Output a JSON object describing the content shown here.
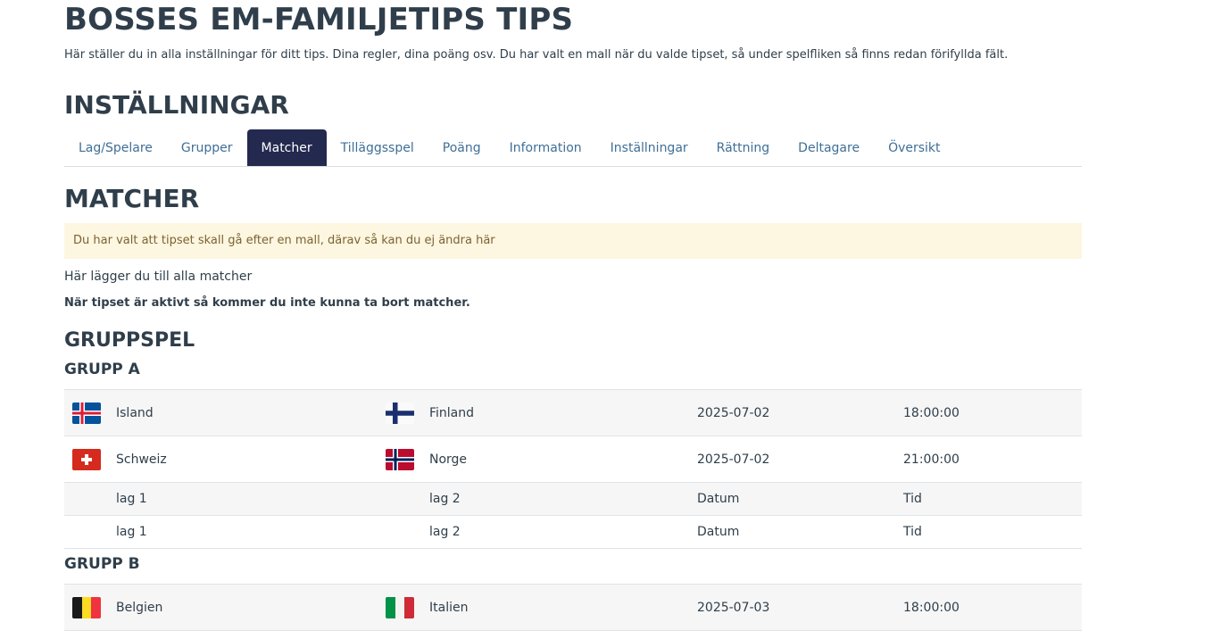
{
  "header": {
    "title": "BOSSES EM-FAMILJETIPS TIPS",
    "intro": "Här ställer du in alla inställningar för ditt tips. Dina regler, dina poäng osv. Du har valt en mall när du valde tipset, så under spelfliken så finns redan förifyllda fält."
  },
  "settings": {
    "title": "INSTÄLLNINGAR",
    "tabs": [
      {
        "label": "Lag/Spelare"
      },
      {
        "label": "Grupper"
      },
      {
        "label": "Matcher",
        "active": true
      },
      {
        "label": "Tilläggsspel"
      },
      {
        "label": "Poäng"
      },
      {
        "label": "Information"
      },
      {
        "label": "Inställningar"
      },
      {
        "label": "Rättning"
      },
      {
        "label": "Deltagare"
      },
      {
        "label": "Översikt"
      }
    ],
    "active_tab_color": "#23294f"
  },
  "matches": {
    "title": "MATCHER",
    "notice": "Du har valt att tipset skall gå efter en mall, därav så kan du ej ändra här",
    "helper": "Här lägger du till alla matcher",
    "warning": "När tipset är aktivt så kommer du inte kunna ta bort matcher.",
    "stage_title": "GRUPPSPEL",
    "groups": [
      {
        "title": "GRUPP A",
        "rows": [
          {
            "flag1": "flag-iceland-icon",
            "team1": "Island",
            "flag2": "flag-finland-icon",
            "team2": "Finland",
            "date": "2025-07-02",
            "time": "18:00:00"
          },
          {
            "flag1": "flag-switzerland-icon",
            "team1": "Schweiz",
            "flag2": "flag-norway-icon",
            "team2": "Norge",
            "date": "2025-07-02",
            "time": "21:00:00"
          },
          {
            "team1": "lag 1",
            "team2": "lag 2",
            "date": "Datum",
            "time": "Tid"
          },
          {
            "team1": "lag 1",
            "team2": "lag 2",
            "date": "Datum",
            "time": "Tid"
          }
        ]
      },
      {
        "title": "GRUPP B",
        "rows": [
          {
            "flag1": "flag-belgium-icon",
            "team1": "Belgien",
            "flag2": "flag-italy-icon",
            "team2": "Italien",
            "date": "2025-07-03",
            "time": "18:00:00"
          }
        ]
      }
    ]
  }
}
